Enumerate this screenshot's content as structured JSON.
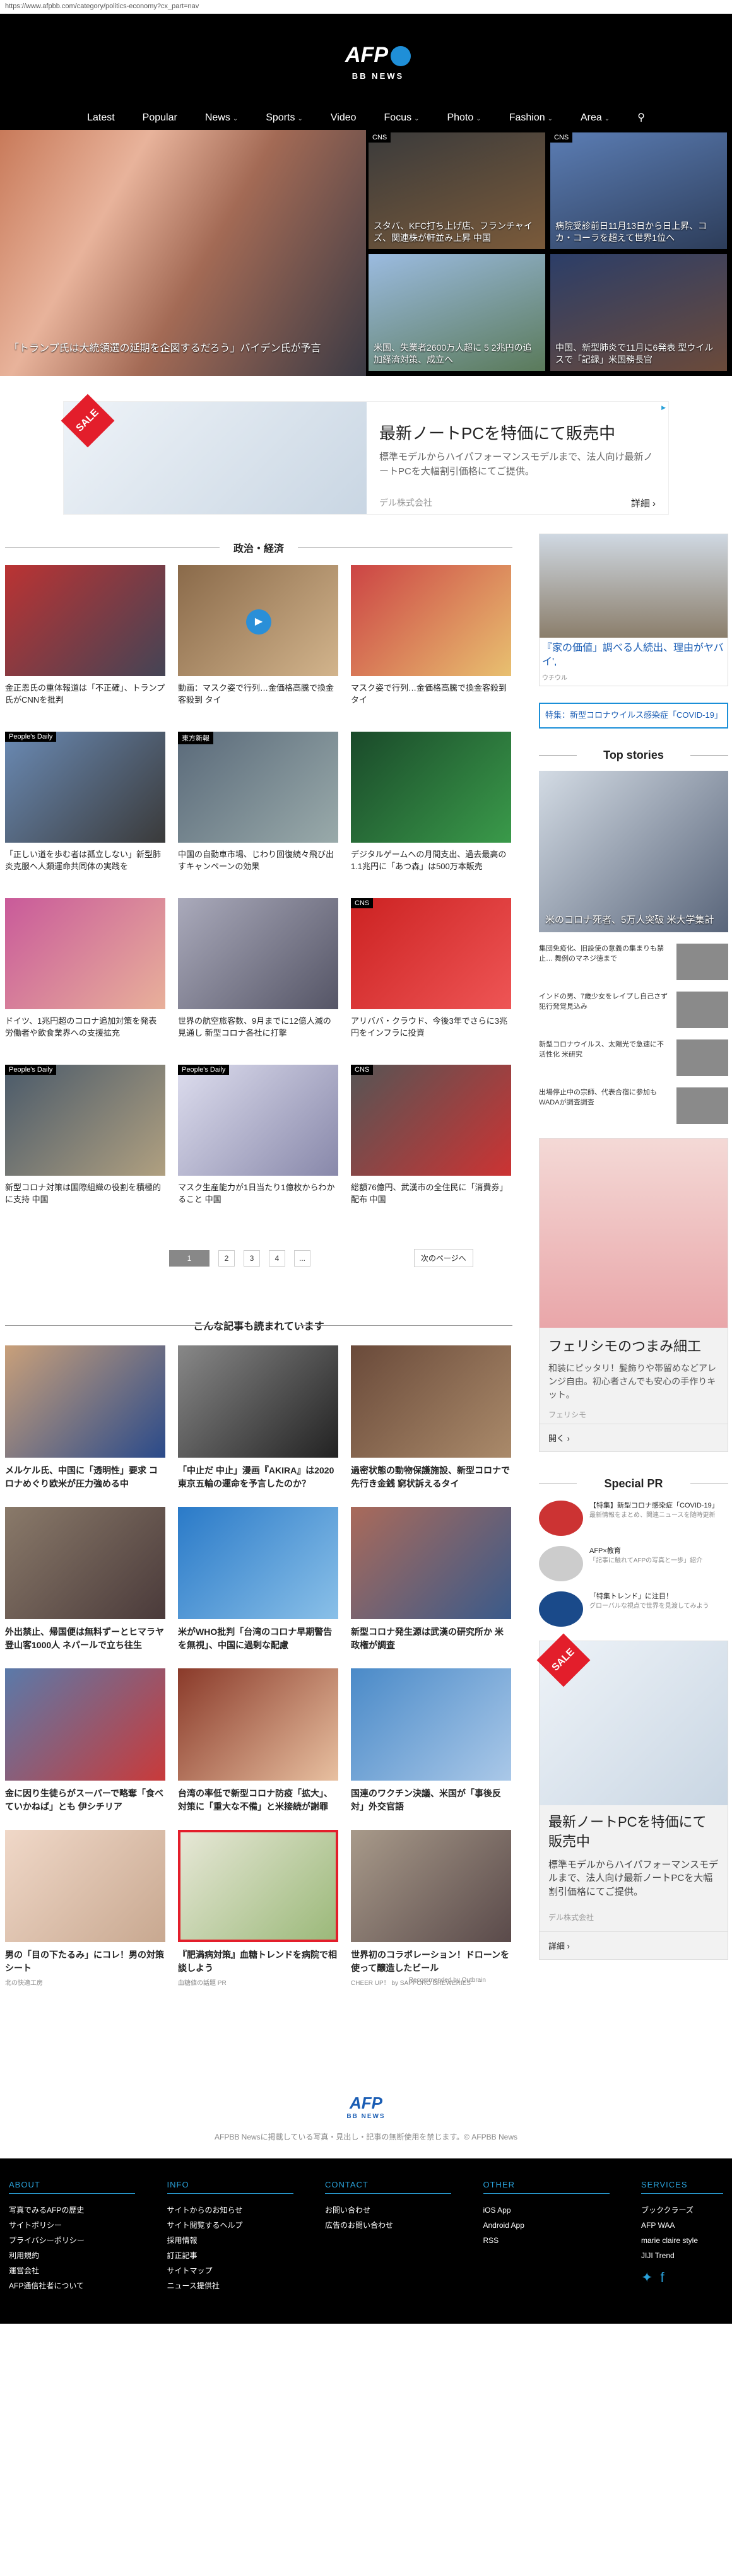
{
  "url": "https://www.afpbb.com/category/politics-economy?cx_part=nav",
  "brand": {
    "mark": "AFP",
    "sub": "BB NEWS"
  },
  "nav": [
    {
      "label": "Latest",
      "has_menu": false
    },
    {
      "label": "Popular",
      "has_menu": false
    },
    {
      "label": "News",
      "has_menu": true
    },
    {
      "label": "Sports",
      "has_menu": true
    },
    {
      "label": "Video",
      "has_menu": false
    },
    {
      "label": "Focus",
      "has_menu": true
    },
    {
      "label": "Photo",
      "has_menu": true
    },
    {
      "label": "Fashion",
      "has_menu": true
    },
    {
      "label": "Area",
      "has_menu": true
    }
  ],
  "hero": {
    "main_caption": "「トランプ氏は大統領選の延期を企図するだろう」バイデン氏が予言",
    "tiles": [
      {
        "badge": "CNS",
        "caption": "スタバ、KFC打ち上げ店、フランチャイズ、関連株が軒並み上昇 中国"
      },
      {
        "badge": "CNS",
        "caption": "病院受診前日11月13日から日上昇、コカ・コーラを超えて世界1位へ"
      },
      {
        "badge": "",
        "caption": "米国、失業者2600万人超に 5 2兆円の追加経済対策、成立へ"
      },
      {
        "badge": "",
        "caption": "中国、新型肺炎で11月に6発表 型ウイルスで「記録」米国務長官"
      }
    ]
  },
  "ad_top": {
    "sale": "SALE",
    "title": "最新ノートPCを特価にて販売中",
    "desc": "標準モデルからハイパフォーマンスモデルまで、法人向け最新ノートPCを大幅割引価格にてご提供。",
    "advertiser": "デル株式会社",
    "cta": "詳細",
    "cta_arrow": "›"
  },
  "section_title": "政治・経済",
  "articles": [
    {
      "badge": "",
      "title": "金正恩氏の重体報道は「不正確」、トランプ氏がCNNを批判"
    },
    {
      "badge": "",
      "title": "動画：マスク姿で行列…金価格高騰で換金客殺到 タイ"
    },
    {
      "badge": "",
      "title": "マスク姿で行列…金価格高騰で換金客殺到 タイ"
    },
    {
      "badge": "People's Daily",
      "title": "「正しい道を歩む者は孤立しない」新型肺炎克服へ人類運命共同体の実践を"
    },
    {
      "badge": "東方新報",
      "title": "中国の自動車市場、じわり回復続々飛び出すキャンペーンの効果"
    },
    {
      "badge": "",
      "title": "デジタルゲームへの月間支出、過去最高の1.1兆円に「あつ森」は500万本販売"
    },
    {
      "badge": "",
      "title": "ドイツ、1兆円超のコロナ追加対策を発表 労働者や飲食業界への支援拡充"
    },
    {
      "badge": "",
      "title": "世界の航空旅客数、9月までに12億人減の見通し 新型コロナ各社に打撃"
    },
    {
      "badge": "CNS",
      "title": "アリババ・クラウド、今後3年でさらに3兆円をインフラに投資"
    },
    {
      "badge": "People's Daily",
      "title": "新型コロナ対策は国際組織の役割を積極的に支持 中国"
    },
    {
      "badge": "People's Daily",
      "title": "マスク生産能力が1日当たり1億枚からわかること 中国"
    },
    {
      "badge": "CNS",
      "title": "総額76億円、武漢市の全住民に「消費券」配布 中国"
    }
  ],
  "pager": {
    "pages": [
      "1",
      "2",
      "3",
      "4",
      "..."
    ],
    "next": "次のページへ"
  },
  "reco_title": "こんな記事も読まれています",
  "reco": [
    {
      "title": "メルケル氏、中国に「透明性」要求 コロナめぐり欧米が圧力強める中",
      "src": ""
    },
    {
      "title": "「中止だ 中止」漫画『AKIRA』は2020東京五輪の運命を予言したのか？",
      "src": ""
    },
    {
      "title": "過密状態の動物保護施設、新型コロナで先行き金銭 窮状訴えるタイ",
      "src": ""
    },
    {
      "title": "外出禁止、帰国便は無料ずーとヒマラヤ登山客1000人 ネパールで立ち往生",
      "src": ""
    },
    {
      "title": "米がWHO批判「台湾のコロナ早期警告を無視」、中国に過剰な配慮",
      "src": ""
    },
    {
      "title": "新型コロナ発生源は武漢の研究所か 米政権が調査",
      "src": ""
    },
    {
      "title": "金に因り生徒らがスーパーで略奪「食べていかねば」とも 伊シチリア",
      "src": ""
    },
    {
      "title": "台湾の率低で新型コロナ防疫「拡大」、対策に「重大な不備」と米接続が謝罪",
      "src": ""
    },
    {
      "title": "国連のワクチン決議、米国が「事後反対」外交官語",
      "src": ""
    },
    {
      "title": "男の「目の下たるみ」にコレ！男の対策シート",
      "src": "北の快適工房"
    },
    {
      "title": "『肥満病対策』血糖トレンドを病院で相談しよう",
      "src": "血糖値の話題 PR"
    },
    {
      "title": "世界初のコラボレーション！ドローンを使って醸造したビール",
      "src": "CHEER UP！ by SAPPORO BREWERIES"
    }
  ],
  "outbrain": "Recommended by Outbrain",
  "side": {
    "promo_title": "『家の価値」調べる人続出、理由がヤバイ',",
    "promo_src": "ウチウル",
    "special_btn": "特集：新型コロナウイルス感染症「COVID-19」",
    "top_stories_title": "Top stories",
    "top_main_caption": "米のコロナ死者、5万人突破 米大学集計",
    "top_items": [
      "集団免疫化、旧設使の意義の集まりも禁止… 舞例のマネジ徳まで",
      "インドの男、7歳少女をレイプし自己さず 犯行発覚見込み",
      "新型コロナウイルス、太陽光で急速に不活性化 米研究",
      "出場停止中の宗師、代表合宿に参加も WADAが調査調査"
    ],
    "ad1": {
      "title": "フェリシモのつまみ細工",
      "desc": "和装にピッタリ！髪飾りや帯留めなどアレンジ自由。初心者さんでも安心の手作りキット。",
      "src": "フェリシモ",
      "cta": "開く",
      "cta_arrow": "›"
    },
    "special_pr_title": "Special PR",
    "pr_items": [
      {
        "title": "【特集】新型コロナ感染症「COVID-19」",
        "src": "最新情報をまとめ、関連ニュースを随時更新"
      },
      {
        "title": "AFP×教育",
        "src": "「記事に触れてAFPの写真と一歩」紹介"
      },
      {
        "title": "「特集トレンド」に注目！",
        "src": "グローバルな視点で世界を見渡してみよう"
      }
    ],
    "ad2": {
      "title": "最新ノートPCを特価にて販売中",
      "desc": "標準モデルからハイパフォーマンスモデルまで、法人向け最新ノートPCを大幅割引価格にてご提供。",
      "src": "デル株式会社",
      "cta": "詳細",
      "cta_arrow": "›"
    }
  },
  "footer_top": {
    "mark": "AFP",
    "sub": "BB NEWS",
    "copy": "AFPBB Newsに掲載している写真・見出し・記事の無断使用を禁じます。© AFPBB News"
  },
  "footer": [
    {
      "h": "ABOUT",
      "links": [
        "写真でみるAFPの歴史",
        "サイトポリシー",
        "プライバシーポリシー",
        "利用規約",
        "運営会社",
        "AFP通信社者について"
      ]
    },
    {
      "h": "INFO",
      "links": [
        "サイトからのお知らせ",
        "サイト閲覧するヘルプ",
        "採用情報",
        "訂正記事",
        "サイトマップ",
        "ニュース提供社"
      ]
    },
    {
      "h": "CONTACT",
      "links": [
        "お問い合わせ",
        "広告のお問い合わせ"
      ]
    },
    {
      "h": "OTHER",
      "links": [
        "iOS App",
        "Android App",
        "RSS"
      ]
    },
    {
      "h": "SERVICES",
      "links": [
        "ブッククラーズ",
        "AFP WAA",
        "marie claire style",
        "JIJI Trend"
      ]
    }
  ]
}
